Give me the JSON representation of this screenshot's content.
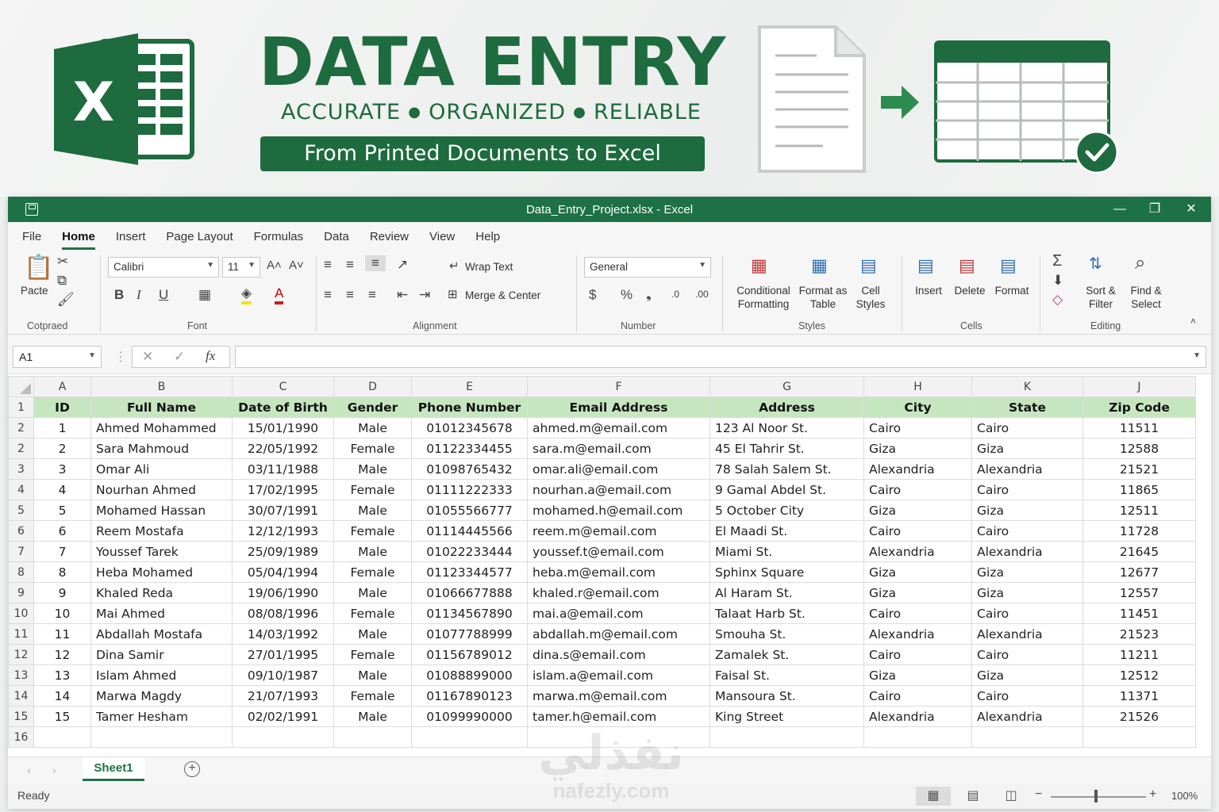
{
  "banner": {
    "headline": "DATA ENTRY",
    "tagline": [
      "ACCURATE",
      "ORGANIZED",
      "RELIABLE"
    ],
    "subtitle": "From Printed Documents to Excel"
  },
  "window": {
    "title": "Data_Entry_Project.xlsx  -  Excel",
    "accent": "#1e7145"
  },
  "menu": [
    "File",
    "Home",
    "Insert",
    "Page Layout",
    "Formulas",
    "Data",
    "Review",
    "View",
    "Help"
  ],
  "ribbon": {
    "clipboard": {
      "paste": "Pacte",
      "label": "Cotpraed"
    },
    "font": {
      "family": "Calibri",
      "size": "11",
      "label": "Font"
    },
    "alignment": {
      "wrap": "Wrap Text",
      "merge": "Merge & Center",
      "label": "Alignment"
    },
    "number": {
      "format": "General",
      "label": "Number"
    },
    "styles": {
      "conditional": [
        "Conditional",
        "Formatting"
      ],
      "format_table": [
        "Format as",
        "Table"
      ],
      "cell_styles": [
        "Cell",
        "Styles"
      ],
      "label": "Styles"
    },
    "cells": {
      "insert": "Insert",
      "delete": "Delete",
      "format": "Format",
      "label": "Cells"
    },
    "editing": {
      "sort": [
        "Sort &",
        "Filter"
      ],
      "find": [
        "Find &",
        "Select"
      ],
      "label": "Editing"
    }
  },
  "formula_bar": {
    "name_box": "A1",
    "fx": "fx"
  },
  "sheet": {
    "columns": [
      "A",
      "B",
      "C",
      "D",
      "E",
      "F",
      "G",
      "H",
      "K",
      "J"
    ],
    "headers": [
      "ID",
      "Full Name",
      "Date of Birth",
      "Gender",
      "Phone Number",
      "Email Address",
      "Address",
      "City",
      "State",
      "Zip Code"
    ],
    "row_numbers": [
      "1",
      "2",
      "2",
      "3",
      "4",
      "5",
      "6",
      "7",
      "8",
      "9",
      "10",
      "11",
      "12",
      "13",
      "14",
      "15",
      "16"
    ],
    "rows": [
      [
        "1",
        "Ahmed Mohammed",
        "15/01/1990",
        "Male",
        "01012345678",
        "ahmed.m@email.com",
        "123 Al Noor St.",
        "Cairo",
        "Cairo",
        "11511"
      ],
      [
        "2",
        "Sara Mahmoud",
        "22/05/1992",
        "Female",
        "01122334455",
        "sara.m@email.com",
        "45 El Tahrir St.",
        "Giza",
        "Giza",
        "12588"
      ],
      [
        "3",
        "Omar Ali",
        "03/11/1988",
        "Male",
        "01098765432",
        "omar.ali@email.com",
        "78 Salah Salem St.",
        "Alexandria",
        "Alexandria",
        "21521"
      ],
      [
        "4",
        "Nourhan Ahmed",
        "17/02/1995",
        "Female",
        "01111222333",
        "nourhan.a@email.com",
        "9 Gamal Abdel St.",
        "Cairo",
        "Cairo",
        "11865"
      ],
      [
        "5",
        "Mohamed Hassan",
        "30/07/1991",
        "Male",
        "01055566777",
        "mohamed.h@email.com",
        "5 October City",
        "Giza",
        "Giza",
        "12511"
      ],
      [
        "6",
        "Reem Mostafa",
        "12/12/1993",
        "Female",
        "01114445566",
        "reem.m@email.com",
        "El Maadi St.",
        "Cairo",
        "Cairo",
        "11728"
      ],
      [
        "7",
        "Youssef Tarek",
        "25/09/1989",
        "Male",
        "01022233444",
        "youssef.t@email.com",
        "Miami St.",
        "Alexandria",
        "Alexandria",
        "21645"
      ],
      [
        "8",
        "Heba Mohamed",
        "05/04/1994",
        "Female",
        "01123344577",
        "heba.m@email.com",
        "Sphinx Square",
        "Giza",
        "Giza",
        "12677"
      ],
      [
        "9",
        "Khaled Reda",
        "19/06/1990",
        "Male",
        "01066677888",
        "khaled.r@email.com",
        "Al Haram St.",
        "Giza",
        "Giza",
        "12557"
      ],
      [
        "10",
        "Mai Ahmed",
        "08/08/1996",
        "Female",
        "01134567890",
        "mai.a@email.com",
        "Talaat Harb St.",
        "Cairo",
        "Cairo",
        "11451"
      ],
      [
        "11",
        "Abdallah Mostafa",
        "14/03/1992",
        "Male",
        "01077788999",
        "abdallah.m@email.com",
        "Smouha St.",
        "Alexandria",
        "Alexandria",
        "21523"
      ],
      [
        "12",
        "Dina Samir",
        "27/01/1995",
        "Female",
        "01156789012",
        "dina.s@email.com",
        "Zamalek St.",
        "Cairo",
        "Cairo",
        "11211"
      ],
      [
        "13",
        "Islam Ahmed",
        "09/10/1987",
        "Male",
        "01088899000",
        "islam.a@email.com",
        "Faisal St.",
        "Giza",
        "Giza",
        "12512"
      ],
      [
        "14",
        "Marwa Magdy",
        "21/07/1993",
        "Female",
        "01167890123",
        "marwa.m@email.com",
        "Mansoura St.",
        "Cairo",
        "Cairo",
        "11371"
      ],
      [
        "15",
        "Tamer Hesham",
        "02/02/1991",
        "Male",
        "01099990000",
        "tamer.h@email.com",
        "King Street",
        "Alexandria",
        "Alexandria",
        "21526"
      ]
    ]
  },
  "tabs": {
    "active": "Sheet1"
  },
  "status": {
    "text": "Ready",
    "zoom": "100%",
    "zoom_level": 1.0
  },
  "watermark": {
    "arabic": "نفذلي",
    "latin": "nafezly.com"
  }
}
